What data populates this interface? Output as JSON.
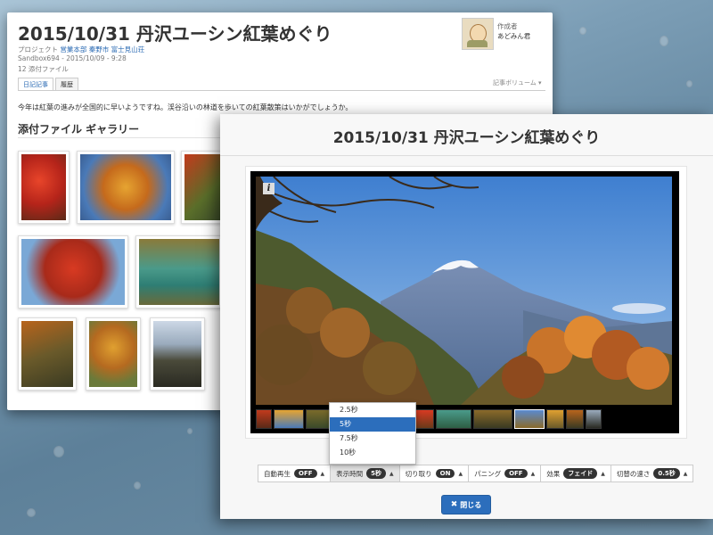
{
  "page": {
    "title": "2015/10/31 丹沢ユーシン紅葉めぐり",
    "project_label": "プロジェクト",
    "project_links": [
      "営業本部",
      "秦野市",
      "富士見山荘"
    ],
    "sandbox_line": "Sandbox694 - 2015/10/09 - 9:28",
    "attachments_count": "12 添付ファイル",
    "author_role": "作成者",
    "author_name": "あどみん君",
    "tabs": [
      "日記記事",
      "履歴"
    ],
    "volume_label": "記事ボリューム",
    "body_text": "今年は紅葉の進みが全国的に早いようですね。渓谷沿いの林道を歩いての紅葉散策はいかがでしょうか。",
    "gallery_title": "添付ファイル ギャラリー"
  },
  "modal": {
    "title": "2015/10/31 丹沢ユーシン紅葉めぐり",
    "info_icon": "i",
    "controls": [
      {
        "label": "自動再生",
        "value": "OFF"
      },
      {
        "label": "表示時間",
        "value": "5秒"
      },
      {
        "label": "切り取り",
        "value": "ON"
      },
      {
        "label": "パニング",
        "value": "OFF"
      },
      {
        "label": "効果",
        "value": "フェイド"
      },
      {
        "label": "切替の速さ",
        "value": "0.5秒"
      }
    ],
    "duration_options": [
      "2.5秒",
      "5秒",
      "7.5秒",
      "10秒"
    ],
    "duration_selected": "5秒",
    "close_label": "閉じる"
  },
  "icons": {
    "info": "info-icon",
    "close": "close-x-icon",
    "caret": "caret-up-icon",
    "volume_caret": "caret-down-icon"
  },
  "colors": {
    "accent": "#2c6ebc",
    "link": "#2a6ab3",
    "pill": "#333333"
  }
}
